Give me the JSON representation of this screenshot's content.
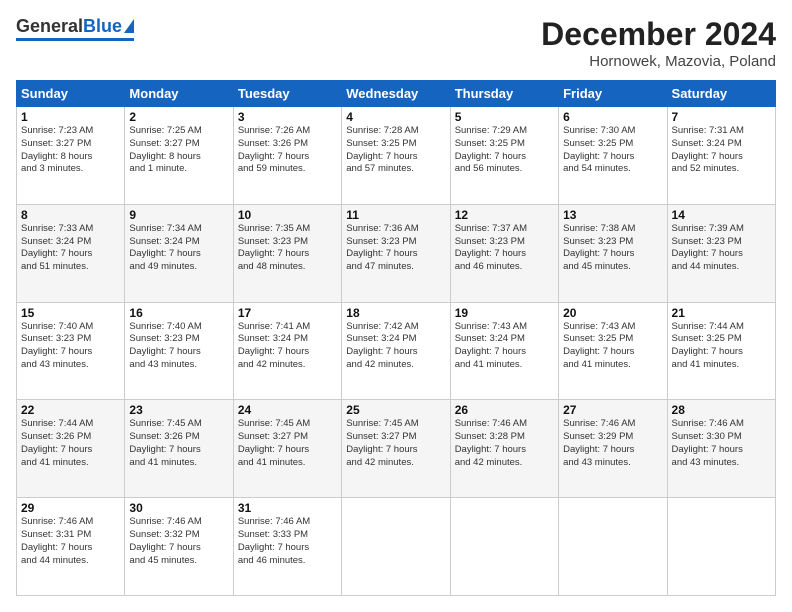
{
  "logo": {
    "general": "General",
    "blue": "Blue"
  },
  "header": {
    "month_title": "December 2024",
    "location": "Hornowek, Mazovia, Poland"
  },
  "days_of_week": [
    "Sunday",
    "Monday",
    "Tuesday",
    "Wednesday",
    "Thursday",
    "Friday",
    "Saturday"
  ],
  "weeks": [
    [
      {
        "day": "1",
        "info": "Sunrise: 7:23 AM\nSunset: 3:27 PM\nDaylight: 8 hours\nand 3 minutes."
      },
      {
        "day": "2",
        "info": "Sunrise: 7:25 AM\nSunset: 3:27 PM\nDaylight: 8 hours\nand 1 minute."
      },
      {
        "day": "3",
        "info": "Sunrise: 7:26 AM\nSunset: 3:26 PM\nDaylight: 7 hours\nand 59 minutes."
      },
      {
        "day": "4",
        "info": "Sunrise: 7:28 AM\nSunset: 3:25 PM\nDaylight: 7 hours\nand 57 minutes."
      },
      {
        "day": "5",
        "info": "Sunrise: 7:29 AM\nSunset: 3:25 PM\nDaylight: 7 hours\nand 56 minutes."
      },
      {
        "day": "6",
        "info": "Sunrise: 7:30 AM\nSunset: 3:25 PM\nDaylight: 7 hours\nand 54 minutes."
      },
      {
        "day": "7",
        "info": "Sunrise: 7:31 AM\nSunset: 3:24 PM\nDaylight: 7 hours\nand 52 minutes."
      }
    ],
    [
      {
        "day": "8",
        "info": "Sunrise: 7:33 AM\nSunset: 3:24 PM\nDaylight: 7 hours\nand 51 minutes."
      },
      {
        "day": "9",
        "info": "Sunrise: 7:34 AM\nSunset: 3:24 PM\nDaylight: 7 hours\nand 49 minutes."
      },
      {
        "day": "10",
        "info": "Sunrise: 7:35 AM\nSunset: 3:23 PM\nDaylight: 7 hours\nand 48 minutes."
      },
      {
        "day": "11",
        "info": "Sunrise: 7:36 AM\nSunset: 3:23 PM\nDaylight: 7 hours\nand 47 minutes."
      },
      {
        "day": "12",
        "info": "Sunrise: 7:37 AM\nSunset: 3:23 PM\nDaylight: 7 hours\nand 46 minutes."
      },
      {
        "day": "13",
        "info": "Sunrise: 7:38 AM\nSunset: 3:23 PM\nDaylight: 7 hours\nand 45 minutes."
      },
      {
        "day": "14",
        "info": "Sunrise: 7:39 AM\nSunset: 3:23 PM\nDaylight: 7 hours\nand 44 minutes."
      }
    ],
    [
      {
        "day": "15",
        "info": "Sunrise: 7:40 AM\nSunset: 3:23 PM\nDaylight: 7 hours\nand 43 minutes."
      },
      {
        "day": "16",
        "info": "Sunrise: 7:40 AM\nSunset: 3:23 PM\nDaylight: 7 hours\nand 43 minutes."
      },
      {
        "day": "17",
        "info": "Sunrise: 7:41 AM\nSunset: 3:24 PM\nDaylight: 7 hours\nand 42 minutes."
      },
      {
        "day": "18",
        "info": "Sunrise: 7:42 AM\nSunset: 3:24 PM\nDaylight: 7 hours\nand 42 minutes."
      },
      {
        "day": "19",
        "info": "Sunrise: 7:43 AM\nSunset: 3:24 PM\nDaylight: 7 hours\nand 41 minutes."
      },
      {
        "day": "20",
        "info": "Sunrise: 7:43 AM\nSunset: 3:25 PM\nDaylight: 7 hours\nand 41 minutes."
      },
      {
        "day": "21",
        "info": "Sunrise: 7:44 AM\nSunset: 3:25 PM\nDaylight: 7 hours\nand 41 minutes."
      }
    ],
    [
      {
        "day": "22",
        "info": "Sunrise: 7:44 AM\nSunset: 3:26 PM\nDaylight: 7 hours\nand 41 minutes."
      },
      {
        "day": "23",
        "info": "Sunrise: 7:45 AM\nSunset: 3:26 PM\nDaylight: 7 hours\nand 41 minutes."
      },
      {
        "day": "24",
        "info": "Sunrise: 7:45 AM\nSunset: 3:27 PM\nDaylight: 7 hours\nand 41 minutes."
      },
      {
        "day": "25",
        "info": "Sunrise: 7:45 AM\nSunset: 3:27 PM\nDaylight: 7 hours\nand 42 minutes."
      },
      {
        "day": "26",
        "info": "Sunrise: 7:46 AM\nSunset: 3:28 PM\nDaylight: 7 hours\nand 42 minutes."
      },
      {
        "day": "27",
        "info": "Sunrise: 7:46 AM\nSunset: 3:29 PM\nDaylight: 7 hours\nand 43 minutes."
      },
      {
        "day": "28",
        "info": "Sunrise: 7:46 AM\nSunset: 3:30 PM\nDaylight: 7 hours\nand 43 minutes."
      }
    ],
    [
      {
        "day": "29",
        "info": "Sunrise: 7:46 AM\nSunset: 3:31 PM\nDaylight: 7 hours\nand 44 minutes."
      },
      {
        "day": "30",
        "info": "Sunrise: 7:46 AM\nSunset: 3:32 PM\nDaylight: 7 hours\nand 45 minutes."
      },
      {
        "day": "31",
        "info": "Sunrise: 7:46 AM\nSunset: 3:33 PM\nDaylight: 7 hours\nand 46 minutes."
      },
      null,
      null,
      null,
      null
    ]
  ]
}
